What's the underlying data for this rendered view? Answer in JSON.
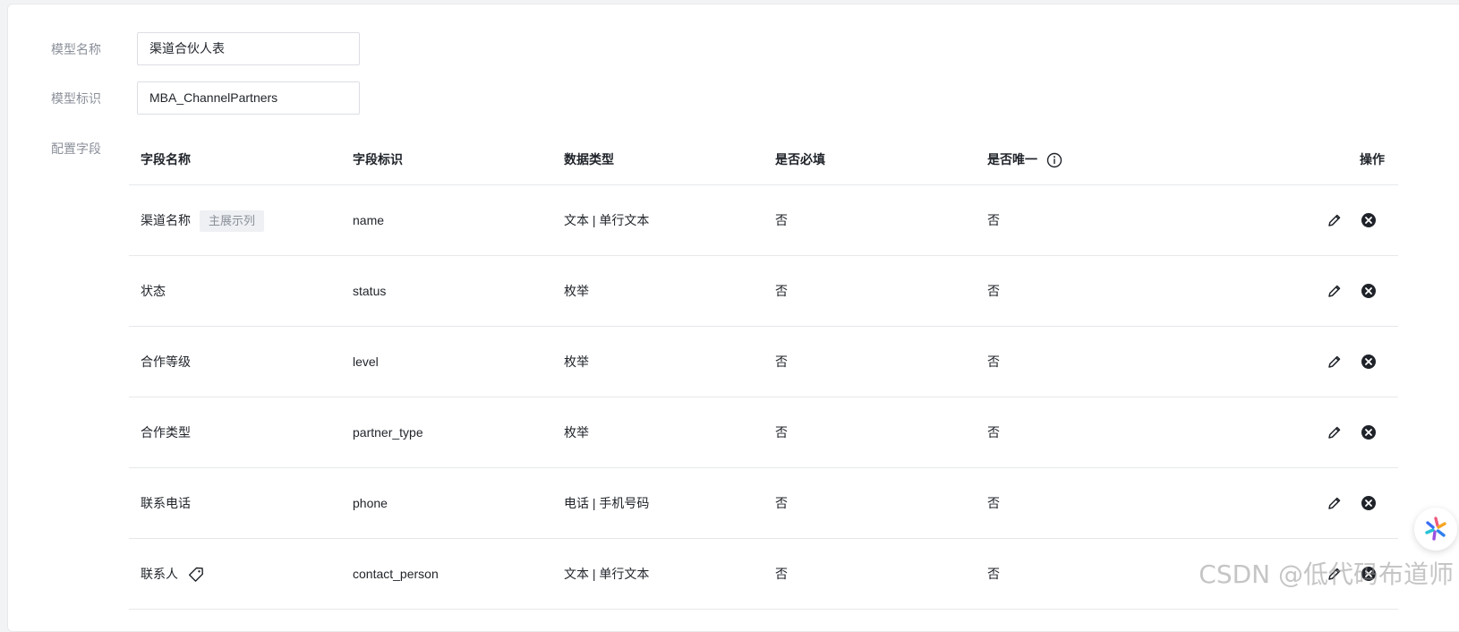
{
  "form": {
    "model_name_label": "模型名称",
    "model_name_value": "渠道合伙人表",
    "model_id_label": "模型标识",
    "model_id_value": "MBA_ChannelPartners",
    "fields_label": "配置字段"
  },
  "table": {
    "headers": {
      "field_name": "字段名称",
      "field_id": "字段标识",
      "data_type": "数据类型",
      "required": "是否必填",
      "unique": "是否唯一",
      "actions": "操作"
    },
    "rows": [
      {
        "name": "渠道名称",
        "tag": "主展示列",
        "id": "name",
        "type": "文本 | 单行文本",
        "required": "否",
        "unique": "否"
      },
      {
        "name": "状态",
        "id": "status",
        "type": "枚举",
        "required": "否",
        "unique": "否"
      },
      {
        "name": "合作等级",
        "id": "level",
        "type": "枚举",
        "required": "否",
        "unique": "否"
      },
      {
        "name": "合作类型",
        "id": "partner_type",
        "type": "枚举",
        "required": "否",
        "unique": "否"
      },
      {
        "name": "联系电话",
        "id": "phone",
        "type": "电话 | 手机号码",
        "required": "否",
        "unique": "否"
      },
      {
        "name": "联系人",
        "id": "contact_person",
        "type": "文本 | 单行文本",
        "required": "否",
        "unique": "否"
      }
    ]
  },
  "icons": {
    "info": "info-icon",
    "edit": "pencil-icon",
    "delete": "close-circle-icon",
    "label_tag": "tag-icon"
  },
  "watermark": "CSDN @低代码布道师"
}
